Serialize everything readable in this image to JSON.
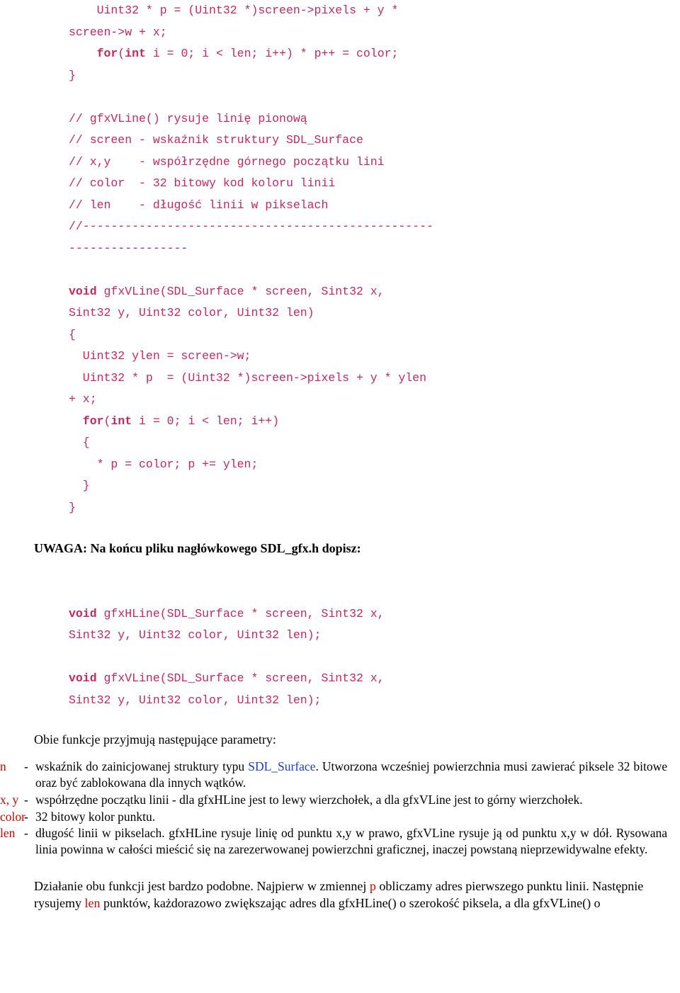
{
  "code1": {
    "l1a": "    Uint32 * p = (Uint32 *)screen->pixels + y * ",
    "l1b": "screen->w + x;",
    "l2a": "    ",
    "l2k1": "for",
    "l2b": "(",
    "l2k2": "int",
    "l2c": " i = 0; i < len; i++) * p++ = color;",
    "l3": "}",
    "l5": "// gfxVLine() rysuje linię pionową",
    "l6": "// screen - wskaźnik struktury SDL_Surface",
    "l7": "// x,y    - współrzędne górnego początku lini",
    "l8": "// color  - 32 bitowy kod koloru linii",
    "l9": "// len    - długość linii w pikselach",
    "l10": "//--------------------------------------------------",
    "l10b": "-----------------",
    "l12a": "void",
    "l12b": " gfxVLine(SDL_Surface * screen, Sint32 x, ",
    "l12c": "Sint32 y, Uint32 color, Uint32 len)",
    "l13": "{",
    "l14": "  Uint32 ylen = screen->w;",
    "l15": "  Uint32 * p  = (Uint32 *)screen->pixels + y * ylen ",
    "l15b": "+ x;",
    "l16a": "  ",
    "l16k1": "for",
    "l16b": "(",
    "l16k2": "int",
    "l16c": " i = 0; i < len; i++)",
    "l17": "  {",
    "l18": "    * p = color; p += ylen;",
    "l19": "  }",
    "l20": "}"
  },
  "heading1": "UWAGA: Na końcu pliku nagłówkowego SDL_gfx.h dopisz:",
  "code2": {
    "l1a": "void",
    "l1b": " gfxHLine(SDL_Surface * screen, Sint32 x, ",
    "l1c": "Sint32 y, Uint32 color, Uint32 len);",
    "l2a": "void",
    "l2b": " gfxVLine(SDL_Surface * screen, Sint32 x, ",
    "l2c": "Sint32 y, Uint32 color, Uint32 len);"
  },
  "intro": "Obie funkcje przyjmują następujące parametry:",
  "params": {
    "p1": {
      "name": "n",
      "dash": "-",
      "desc_a": "wskaźnik do zainicjowanej struktury typu ",
      "desc_link": "SDL_Surface",
      "desc_b": ". Utworzona wcześniej powierzchnia musi zawierać piksele 32 bitowe oraz być zablokowana dla innych wątków."
    },
    "p2": {
      "name": "x, y",
      "dash": "-",
      "desc": "współrzędne początku linii - dla gfxHLine jest to lewy wierzchołek, a dla gfxVLine jest to górny wierzchołek."
    },
    "p3": {
      "name": "color",
      "dash": "-",
      "desc": "32 bitowy kolor punktu."
    },
    "p4": {
      "name": "len",
      "dash": "-",
      "desc": "długość linii w pikselach. gfxHLine rysuje linię od punktu x,y w prawo, gfxVLine rysuje ją od punktu x,y w dół. Rysowana linia powinna w całości mieścić się na zarezerwowanej powierzchni graficznej, inaczej powstaną nieprzewidywalne efekty."
    }
  },
  "closing_a": "Działanie obu funkcji jest bardzo podobne. Najpierw w zmiennej ",
  "closing_p": "p",
  "closing_b": " obliczamy adres pierwszego punktu linii. Następnie rysujemy ",
  "closing_len": "len",
  "closing_c": " punktów, każdorazowo zwiększając adres dla gfxHLine() o szerokość piksela, a dla gfxVLine() o"
}
